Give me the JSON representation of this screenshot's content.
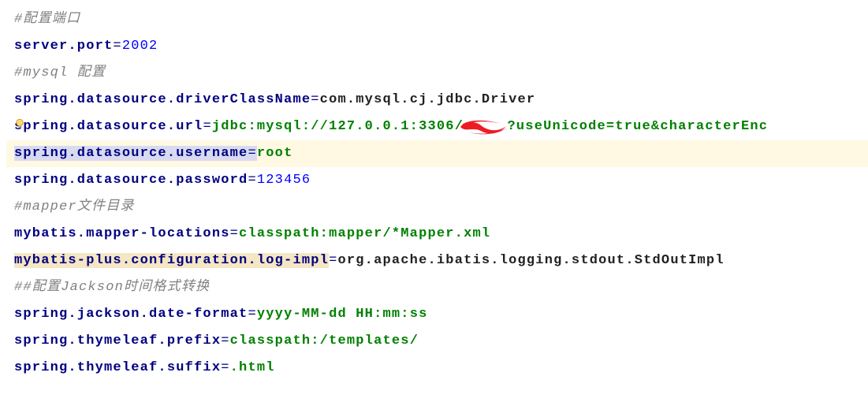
{
  "lines": {
    "c1": "#配置端口",
    "serverPort": {
      "key": "server.port",
      "value": "2002"
    },
    "c2": "#mysql 配置",
    "driver": {
      "key": "spring.datasource.driverClassName",
      "value": "com.mysql.cj.jdbc.Driver"
    },
    "url": {
      "key": "spring.datasource.url",
      "value_pre": "jdbc:mysql://127.0.0.1:3306/",
      "value_post": "?useUnicode=true&characterEnc"
    },
    "user": {
      "key": "spring.datasource.username",
      "value": "root"
    },
    "pass": {
      "key": "spring.datasource.password",
      "value": "123456"
    },
    "c3": "#mapper文件目录",
    "mapperLoc": {
      "key": "mybatis.mapper-locations",
      "value": "classpath:mapper/*Mapper.xml"
    },
    "logImpl": {
      "key": "mybatis-plus.configuration.log-impl",
      "value": "org.apache.ibatis.logging.stdout.StdOutImpl"
    },
    "c4": "##配置Jackson时间格式转换",
    "dateFmt": {
      "key": "spring.jackson.date-format",
      "value": "yyyy-MM-dd HH:mm:ss"
    },
    "thPrefix": {
      "key": "spring.thymeleaf.prefix",
      "value": "classpath:/templates/"
    },
    "thSuffix": {
      "key": "spring.thymeleaf.suffix",
      "value": ".html"
    }
  },
  "colors": {
    "key": "#000080",
    "comment": "#808080",
    "number": "#0000ff",
    "string": "#008000",
    "selection": "#d8dbf0",
    "warn_hl": "#f5e6c4",
    "line_hl": "#fff9e3",
    "redaction": "#ed1c24"
  }
}
